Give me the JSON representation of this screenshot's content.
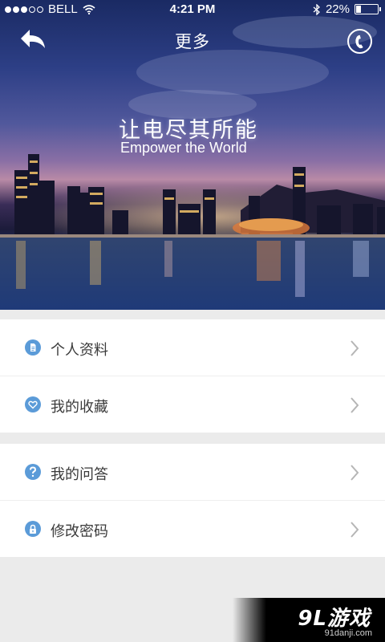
{
  "status_bar": {
    "carrier": "BELL",
    "time": "4:21 PM",
    "battery": "22%",
    "battery_level": 0.22,
    "signal_bars": 3,
    "icons": [
      "signal-dots-icon",
      "wifi-icon",
      "bluetooth-icon",
      "battery-icon"
    ]
  },
  "nav": {
    "title": "更多",
    "back_icon": "back-arrow-icon",
    "phone_icon": "phone-icon"
  },
  "hero": {
    "slogan_cn": "让电尽其所能",
    "slogan_en": "Empower the World"
  },
  "menu": {
    "group1": [
      {
        "label": "个人资料",
        "icon": "document-icon"
      },
      {
        "label": "我的收藏",
        "icon": "heart-icon"
      }
    ],
    "group2": [
      {
        "label": "我的问答",
        "icon": "question-icon"
      },
      {
        "label": "修改密码",
        "icon": "lock-icon"
      }
    ]
  },
  "watermark": {
    "logo": "9L游戏",
    "url": "91danji.com"
  },
  "colors": {
    "accent": "#5b9bd8",
    "background": "#ebebeb",
    "chevron": "#b5b5b5"
  }
}
